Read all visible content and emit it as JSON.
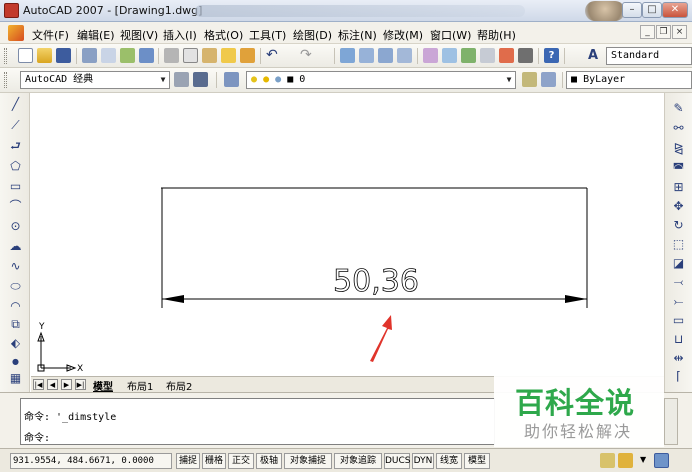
{
  "window": {
    "title": "AutoCAD 2007 - [Drawing1.dwg]",
    "minimize": "–",
    "maximize": "□",
    "close": "✕"
  },
  "menu": {
    "items": [
      "文件(F)",
      "编辑(E)",
      "视图(V)",
      "插入(I)",
      "格式(O)",
      "工具(T)",
      "绘图(D)",
      "标注(N)",
      "修改(M)",
      "窗口(W)",
      "帮助(H)"
    ],
    "mdi_min": "_",
    "mdi_restore": "❐",
    "mdi_close": "×"
  },
  "toolbar1": {
    "text_style": "Standard"
  },
  "toolbar2": {
    "workspace": "AutoCAD 经典",
    "layer": "0",
    "color": "ByLayer"
  },
  "drawing": {
    "dimension_text": "50,36",
    "ucs_y": "Y",
    "ucs_x": "X",
    "arrow_color": "#e0342b",
    "line_color": "#000000"
  },
  "tabs": {
    "nav": [
      "|◀",
      "◀",
      "▶",
      "▶|"
    ],
    "items": [
      "模型",
      "布局1",
      "布局2"
    ]
  },
  "command": {
    "line1": "命令: '_dimstyle",
    "line2": "命令:"
  },
  "status": {
    "coords": "931.9554, 484.6671, 0.0000",
    "buttons": [
      "捕捉",
      "栅格",
      "正交",
      "极轴",
      "对象捕捉",
      "对象追踪",
      "DUCS",
      "DYN",
      "线宽",
      "模型"
    ]
  },
  "watermark": {
    "title": "百科全说",
    "subtitle": "助你轻松解决",
    "color": "#2ea84b"
  }
}
